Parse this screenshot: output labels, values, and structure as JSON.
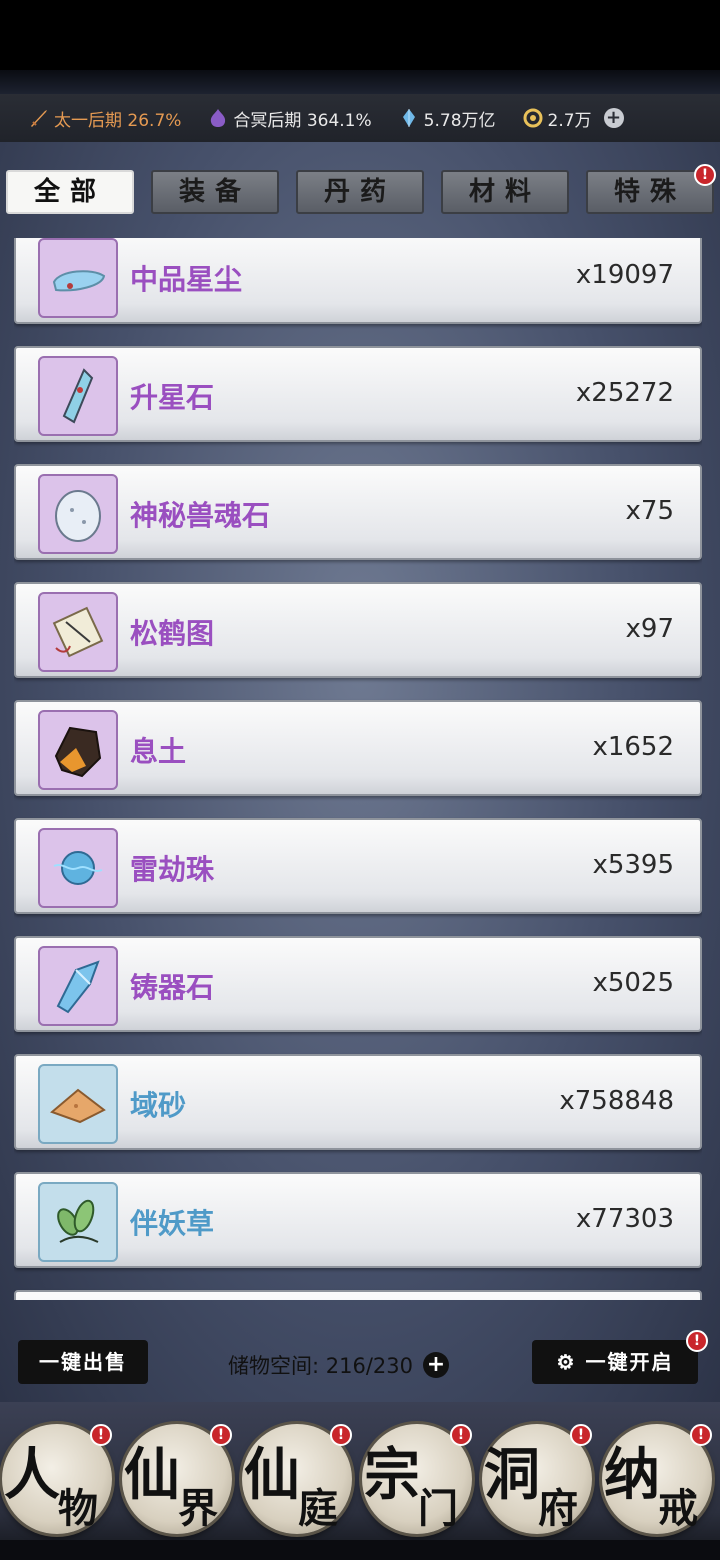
{
  "resources": {
    "realm": "太一后期 26.7%",
    "realm2": "合冥后期 364.1%",
    "crystal": "5.78万亿",
    "coin": "2.7万",
    "add": "+"
  },
  "tabs": [
    {
      "label": "全部",
      "active": true
    },
    {
      "label": "装备",
      "active": false
    },
    {
      "label": "丹药",
      "active": false
    },
    {
      "label": "材料",
      "active": false
    },
    {
      "label": "特殊",
      "active": false,
      "badge": "!"
    }
  ],
  "items": [
    {
      "name": "中品星尘",
      "count": "x19097",
      "rarity": "purple",
      "icon": "stardust-icon"
    },
    {
      "name": "升星石",
      "count": "x25272",
      "rarity": "purple",
      "icon": "star-stone-icon"
    },
    {
      "name": "神秘兽魂石",
      "count": "x75",
      "rarity": "purple",
      "icon": "beast-soul-stone-icon"
    },
    {
      "name": "松鹤图",
      "count": "x97",
      "rarity": "purple",
      "icon": "scroll-icon"
    },
    {
      "name": "息土",
      "count": "x1652",
      "rarity": "purple",
      "icon": "earth-ore-icon"
    },
    {
      "name": "雷劫珠",
      "count": "x5395",
      "rarity": "purple",
      "icon": "thunder-orb-icon"
    },
    {
      "name": "铸器石",
      "count": "x5025",
      "rarity": "purple",
      "icon": "crystal-icon"
    },
    {
      "name": "域砂",
      "count": "x758848",
      "rarity": "blue",
      "icon": "sand-pile-icon"
    },
    {
      "name": "伴妖草",
      "count": "x77303",
      "rarity": "blue",
      "icon": "herb-icon"
    }
  ],
  "bottom": {
    "sell_label": "一键出售",
    "storage_label": "储物空间: 216/230",
    "add": "+",
    "open_label": "一键开启",
    "open_badge": "!"
  },
  "nav": [
    {
      "c1": "人",
      "c2": "物",
      "badge": "!"
    },
    {
      "c1": "仙",
      "c2": "界",
      "badge": "!"
    },
    {
      "c1": "仙",
      "c2": "庭",
      "badge": "!"
    },
    {
      "c1": "宗",
      "c2": "门",
      "badge": "!"
    },
    {
      "c1": "洞",
      "c2": "府",
      "badge": "!"
    },
    {
      "c1": "纳",
      "c2": "戒",
      "badge": "!"
    }
  ],
  "colors": {
    "purple_rarity": "#9a4fc0",
    "blue_rarity": "#4f9ac8",
    "realm_text": "#e59a52",
    "badge_red": "#c9262b"
  }
}
